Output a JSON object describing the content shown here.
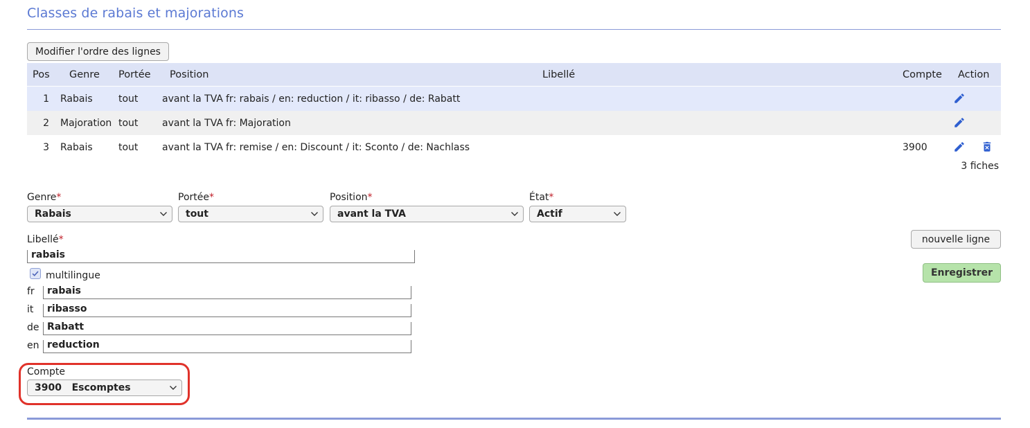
{
  "page": {
    "title": "Classes de rabais et majorations"
  },
  "toolbar": {
    "reorder_label": "Modifier l'ordre des lignes"
  },
  "table": {
    "headers": {
      "pos": "Pos",
      "genre": "Genre",
      "portee": "Portée",
      "position": "Position",
      "libelle": "Libellé",
      "compte": "Compte",
      "action": "Action"
    },
    "rows": [
      {
        "pos": "1",
        "genre": "Rabais",
        "portee": "tout",
        "position": "avant la TVA",
        "libelle": "fr: rabais / en: reduction / it: ribasso / de: Rabatt",
        "compte": ""
      },
      {
        "pos": "2",
        "genre": "Majoration",
        "portee": "tout",
        "position": "avant la TVA",
        "libelle": "fr: Majoration",
        "compte": ""
      },
      {
        "pos": "3",
        "genre": "Rabais",
        "portee": "tout",
        "position": "avant la TVA",
        "libelle": "fr: remise / en: Discount / it: Sconto / de: Nachlass",
        "compte": "3900"
      }
    ],
    "count_label": "3 fiches",
    "icons": {
      "edit": "pencil-icon",
      "delete": "trash-icon"
    }
  },
  "form": {
    "genre": {
      "label": "Genre",
      "required": "*",
      "value": "Rabais"
    },
    "portee": {
      "label": "Portée",
      "required": "*",
      "value": "tout"
    },
    "position": {
      "label": "Position",
      "required": "*",
      "value": "avant la TVA"
    },
    "etat": {
      "label": "État",
      "required": "*",
      "value": "Actif"
    },
    "libelle": {
      "label": "Libellé",
      "required": "*",
      "value": "rabais"
    },
    "multilingue": {
      "label": "multilingue",
      "checked": true
    },
    "translations": [
      {
        "lang": "fr",
        "value": "rabais"
      },
      {
        "lang": "it",
        "value": "ribasso"
      },
      {
        "lang": "de",
        "value": "Rabatt"
      },
      {
        "lang": "en",
        "value": "reduction"
      }
    ],
    "compte": {
      "label": "Compte",
      "value": "3900   Escomptes"
    },
    "new_line_label": "nouvelle ligne",
    "save_label": "Enregistrer"
  },
  "colors": {
    "accent": "#5b79d3",
    "icon_blue": "#2f5fd0",
    "save_green": "#b6e3aa",
    "highlight_red": "#e0322a",
    "required_red": "#c0202a"
  }
}
